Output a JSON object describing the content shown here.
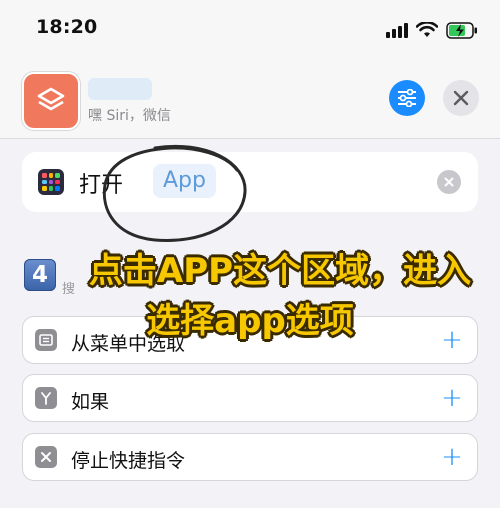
{
  "status_bar": {
    "time": "18:20"
  },
  "header": {
    "subtitle": "嘿 Siri，微信"
  },
  "action": {
    "verb": "打开",
    "token": "App"
  },
  "step": {
    "number": "4",
    "hint": "搜"
  },
  "caption": {
    "line1": "点击APP这个区域，进入",
    "line2": "选择app选项"
  },
  "suggestions": [
    {
      "label": "从菜单中选取",
      "icon": "menu-icon"
    },
    {
      "label": "如果",
      "icon": "branch-icon"
    },
    {
      "label": "停止快捷指令",
      "icon": "stop-icon"
    }
  ],
  "colors": {
    "accent": "#1a8cff",
    "app_icon": "#f0785c",
    "caption": "#f7c800"
  }
}
